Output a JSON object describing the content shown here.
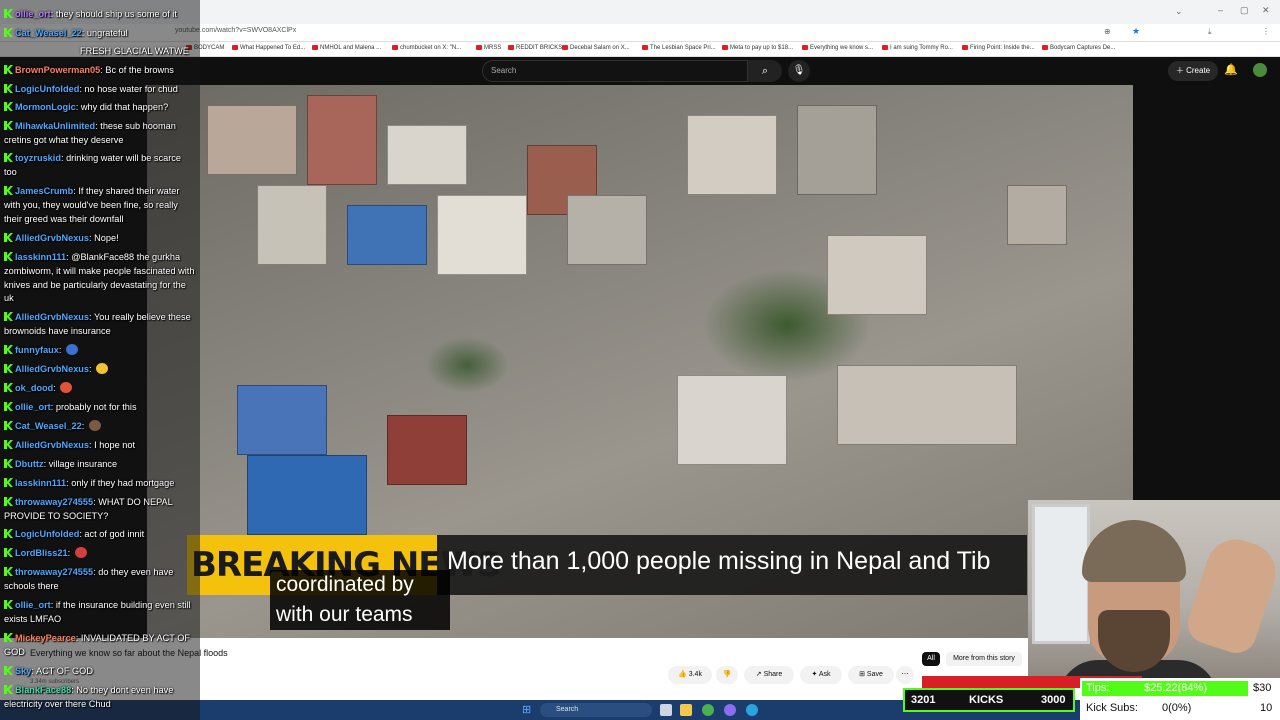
{
  "browser": {
    "url": "youtube.com/watch?v=SWVO8AXClPx",
    "bookmarks": [
      "BODYCAM",
      "What Happened To Ed...",
      "NMHOL and Malena ...",
      "chumbucket on X: \"N...",
      "MRSS",
      "REDDIT BRICKS",
      "Decebal Salam on X...",
      "The Lesbian Space Pri...",
      "Meta to pay up to $18...",
      "Everything we know s...",
      "I am suing Tommy Ro...",
      "Firing Point: Inside the...",
      "Bodycam Captures De..."
    ]
  },
  "youtube": {
    "search_placeholder": "Search",
    "create_label": "Create",
    "video_title": "Everything we know so far about the Nepal floods",
    "channel_subs": "3.34m subscribers",
    "like_count": "3.4k",
    "share_label": "Share",
    "ask_label": "Ask",
    "save_label": "Save",
    "chip_all": "All",
    "chip_more": "More from this story"
  },
  "video": {
    "breaking_label": "BREAKING NEWS",
    "headline": "More than 1,000 people missing in Nepal and Tib",
    "caption_line1": "coordinated by",
    "caption_line2": "with our teams"
  },
  "chat": [
    {
      "user": "ollie_ort",
      "text": "they should ship us some of it",
      "color": "c1"
    },
    {
      "user": "Cat_Weasel_22",
      "text": "ungrateful",
      "color": "c2"
    },
    {
      "user": "",
      "text": "FRESH GLACIAL WATWE",
      "color": "c1"
    },
    {
      "user": "BrownPowerman05",
      "text": "Bc of the browns",
      "color": "c4"
    },
    {
      "user": "LogicUnfolded",
      "text": "no hose water for chud",
      "color": "c2"
    },
    {
      "user": "MormonLogic",
      "text": "why did that happen?",
      "color": "c2"
    },
    {
      "user": "MihawkaUnlimited",
      "text": "these sub hooman cretins got what they deserve",
      "color": "c2"
    },
    {
      "user": "toyzruskid",
      "text": "drinking water will be scarce too",
      "color": "c2"
    },
    {
      "user": "JamesCrumb",
      "text": "If they shared their water with you, they would've been fine, so really their greed was their downfall",
      "color": "c2"
    },
    {
      "user": "AlliedGrvbNexus",
      "text": "Nope!",
      "color": "c2"
    },
    {
      "user": "lasskinn111",
      "text": "@BlankFace88 the gurkha zombiworm, it will make people fascinated with knives and be particularly devastating for the uk",
      "color": "c2"
    },
    {
      "user": "AlliedGrvbNexus",
      "text": "You really believe these brownoids have insurance",
      "color": "c2"
    },
    {
      "user": "funnyfaux",
      "text": "",
      "color": "c2"
    },
    {
      "user": "AlliedGrvbNexus",
      "text": "",
      "color": "c2"
    },
    {
      "user": "ok_dood",
      "text": "",
      "color": "c2"
    },
    {
      "user": "ollie_ort",
      "text": "probably not for this",
      "color": "c2"
    },
    {
      "user": "Cat_Weasel_22",
      "text": "",
      "color": "c2"
    },
    {
      "user": "AlliedGrvbNexus",
      "text": "I hope not",
      "color": "c2"
    },
    {
      "user": "Dbuttz",
      "text": "village insurance",
      "color": "c2"
    },
    {
      "user": "lasskinn111",
      "text": "only if they had mortgage",
      "color": "c2"
    },
    {
      "user": "throwaway274555",
      "text": "WHAT DO NEPAL PROVIDE TO SOCIETY?",
      "color": "c2"
    },
    {
      "user": "LogicUnfolded",
      "text": "act of god innit",
      "color": "c2"
    },
    {
      "user": "LordBliss21",
      "text": "",
      "color": "c2"
    },
    {
      "user": "throwaway274555",
      "text": "do they even have schools there",
      "color": "c2"
    },
    {
      "user": "ollie_ort",
      "text": "if the insurance building even still exists LMFAO",
      "color": "c2"
    },
    {
      "user": "MickeyPearce",
      "text": "INVALIDATED BY ACT OF GOD",
      "color": "c4"
    },
    {
      "user": "Sky",
      "text": "ACT OF GOD",
      "color": "c2"
    },
    {
      "user": "BlankFace88",
      "text": "No they dont even have electricity over there Chud",
      "color": "c3"
    }
  ],
  "overlay": {
    "kicks_left": "3201",
    "kicks_label": "KICKS",
    "kicks_right": "3000",
    "tips_label": "Tips:",
    "tips_value": "$25.22(84%)",
    "tips_goal": "$30",
    "subs_label": "Kick Subs:",
    "subs_value": "0(0%)",
    "subs_goal": "10"
  },
  "taskbar": {
    "search_label": "Search"
  },
  "colors": {
    "kick_green": "#53fc18",
    "breaking_yellow": "#f4c20d",
    "youtube_dark": "#0f0f0f",
    "taskbar_blue": "#1a3d6d"
  }
}
